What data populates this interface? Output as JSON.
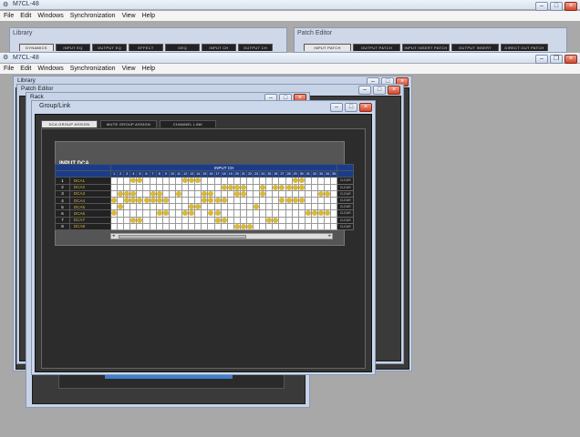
{
  "back_window": {
    "title": "M7CL-48",
    "menu": [
      "File",
      "Edit",
      "Windows",
      "Synchronization",
      "View",
      "Help"
    ],
    "library_label": "Library",
    "library_tabs": [
      "DYNAMICS",
      "INPUT EQ",
      "OUTPUT EQ",
      "EFFECT",
      "GEQ",
      "INPUT CH",
      "OUTPUT CH"
    ],
    "patch_label": "Patch Editor",
    "patch_tabs": [
      "INPUT PATCH",
      "OUTPUT PATCH",
      "INPUT INSERT PATCH",
      "OUTPUT INSERT PATCH",
      "DIRECT OUT PATCH"
    ]
  },
  "main_window": {
    "title": "M7CL-48",
    "menu": [
      "File",
      "Edit",
      "Windows",
      "Synchronization",
      "View",
      "Help"
    ]
  },
  "library_window": {
    "title": "Library"
  },
  "patch_editor_window": {
    "title": "Patch Editor"
  },
  "rack_window": {
    "title": "Rack"
  },
  "group_link": {
    "title": "Group/Link",
    "tabs": [
      "DCA GROUP ASSIGN",
      "MUTE GROUP ASSIGN",
      "CHANNEL LINK"
    ],
    "active_tab": 0,
    "section_label": "INPUT DCA",
    "header_label": "INPUT CH",
    "channel_numbers": [
      "1",
      "2",
      "3",
      "4",
      "5",
      "6",
      "7",
      "8",
      "9",
      "10",
      "11",
      "12",
      "13",
      "14",
      "15",
      "16",
      "17",
      "18",
      "19",
      "20",
      "21",
      "22",
      "23",
      "24",
      "25",
      "26",
      "27",
      "28",
      "29",
      "30",
      "31",
      "32",
      "33",
      "34",
      "35"
    ],
    "clear_label": "CLEAR",
    "rows": [
      {
        "num": "1",
        "name": "DCA1",
        "assign": [
          4,
          5,
          12,
          13,
          14,
          29,
          30
        ]
      },
      {
        "num": "2",
        "name": "DCA2",
        "assign": [
          18,
          19,
          20,
          21,
          24,
          26,
          27,
          28,
          29,
          30
        ]
      },
      {
        "num": "3",
        "name": "DCA3",
        "assign": [
          2,
          3,
          4,
          7,
          8,
          11,
          15,
          16,
          20,
          21,
          24,
          33,
          34
        ]
      },
      {
        "num": "4",
        "name": "DCA4",
        "assign": [
          1,
          3,
          4,
          5,
          6,
          7,
          8,
          9,
          15,
          16,
          17,
          18,
          27,
          28,
          29,
          30
        ]
      },
      {
        "num": "5",
        "name": "DCA5",
        "assign": [
          2,
          13,
          14,
          23
        ]
      },
      {
        "num": "6",
        "name": "DCA6",
        "assign": [
          1,
          8,
          9,
          12,
          13,
          16,
          17,
          31,
          32,
          33,
          34
        ]
      },
      {
        "num": "7",
        "name": "DCA7",
        "assign": [
          4,
          5,
          17,
          18,
          25,
          26
        ]
      },
      {
        "num": "8",
        "name": "DCA8",
        "assign": [
          20,
          21,
          22
        ]
      }
    ]
  },
  "colors": {
    "assign_dot": "#d9b83a",
    "header_blue": "#1d3c88",
    "panel_dark": "#3a3a3a"
  }
}
